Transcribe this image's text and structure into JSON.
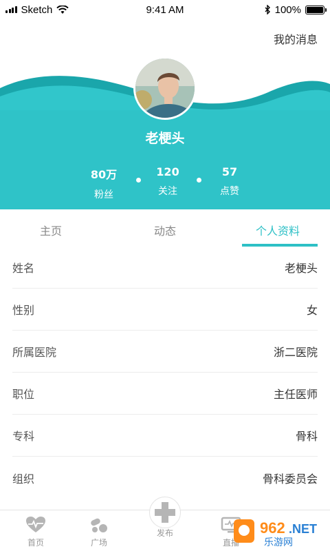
{
  "status_bar": {
    "carrier": "Sketch",
    "time": "9:41 AM",
    "battery": "100%"
  },
  "header": {
    "messages_link": "我的消息",
    "username": "老梗头"
  },
  "stats": [
    {
      "value": "80万",
      "label": "粉丝"
    },
    {
      "value": "120",
      "label": "关注"
    },
    {
      "value": "57",
      "label": "点赞"
    }
  ],
  "tabs": [
    {
      "label": "主页"
    },
    {
      "label": "动态"
    },
    {
      "label": "个人资料",
      "active": true
    }
  ],
  "profile": [
    {
      "label": "姓名",
      "value": "老梗头"
    },
    {
      "label": "性别",
      "value": "女"
    },
    {
      "label": "所属医院",
      "value": "浙二医院"
    },
    {
      "label": "职位",
      "value": "主任医师"
    },
    {
      "label": "专科",
      "value": "骨科"
    },
    {
      "label": "组织",
      "value": "骨科委员会"
    }
  ],
  "bottom_nav": [
    {
      "label": "首页",
      "icon": "heart-pulse-icon"
    },
    {
      "label": "广场",
      "icon": "pills-icon"
    },
    {
      "label": "发布",
      "icon": "medical-cross-icon"
    },
    {
      "label": "直播",
      "icon": "monitor-icon"
    }
  ],
  "watermark": {
    "brand": "962.NET",
    "subtitle": "乐游网"
  },
  "colors": {
    "accent": "#2ec0c6",
    "accent_dark": "#1ba8ad",
    "text": "#333333",
    "muted": "#888888"
  }
}
